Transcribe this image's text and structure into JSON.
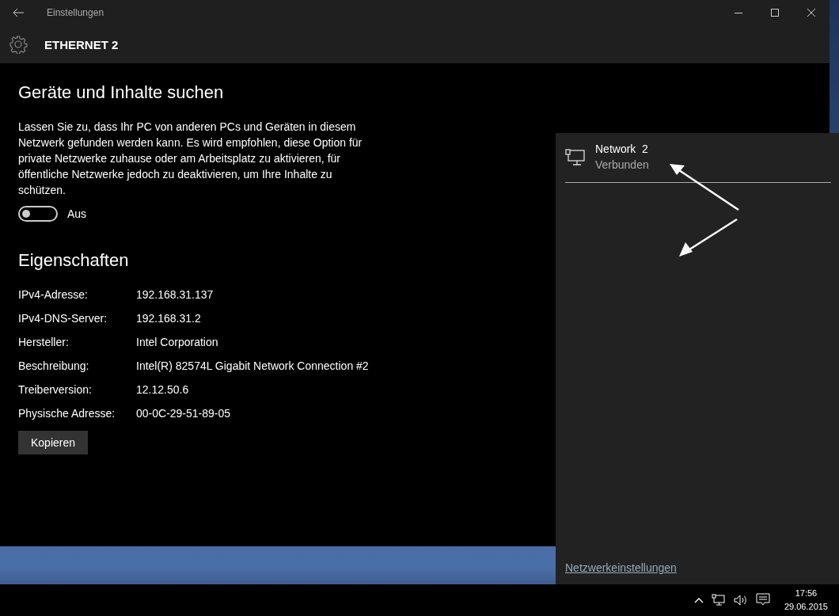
{
  "window": {
    "title": "Einstellungen",
    "header": "ETHERNET 2"
  },
  "discovery": {
    "heading": "Geräte und Inhalte suchen",
    "description": "Lassen Sie zu, dass Ihr PC von anderen PCs und Geräten in diesem Netzwerk gefunden werden kann. Es wird empfohlen, diese Option für private Netzwerke zuhause oder am Arbeitsplatz zu aktivieren, für öffentliche Netzwerke jedoch zu deaktivieren, um Ihre Inhalte zu schützen.",
    "toggle": {
      "on": false,
      "label": "Aus"
    }
  },
  "properties": {
    "heading": "Eigenschaften",
    "rows": [
      {
        "label": "IPv4-Adresse:",
        "value": "192.168.31.137"
      },
      {
        "label": "IPv4-DNS-Server:",
        "value": "192.168.31.2"
      },
      {
        "label": "Hersteller:",
        "value": "Intel Corporation"
      },
      {
        "label": "Beschreibung:",
        "value": "Intel(R) 82574L Gigabit Network Connection #2"
      },
      {
        "label": "Treiberversion:",
        "value": "12.12.50.6"
      },
      {
        "label": "Physische Adresse:",
        "value": "00-0C-29-51-89-05"
      }
    ],
    "button": "Kopieren"
  },
  "network_flyout": {
    "network": {
      "name": "Network  2",
      "status": "Verbunden"
    },
    "link": "Netzwerkeinstellungen"
  },
  "taskbar": {
    "time": "17:56",
    "date": "29.06.2015"
  }
}
